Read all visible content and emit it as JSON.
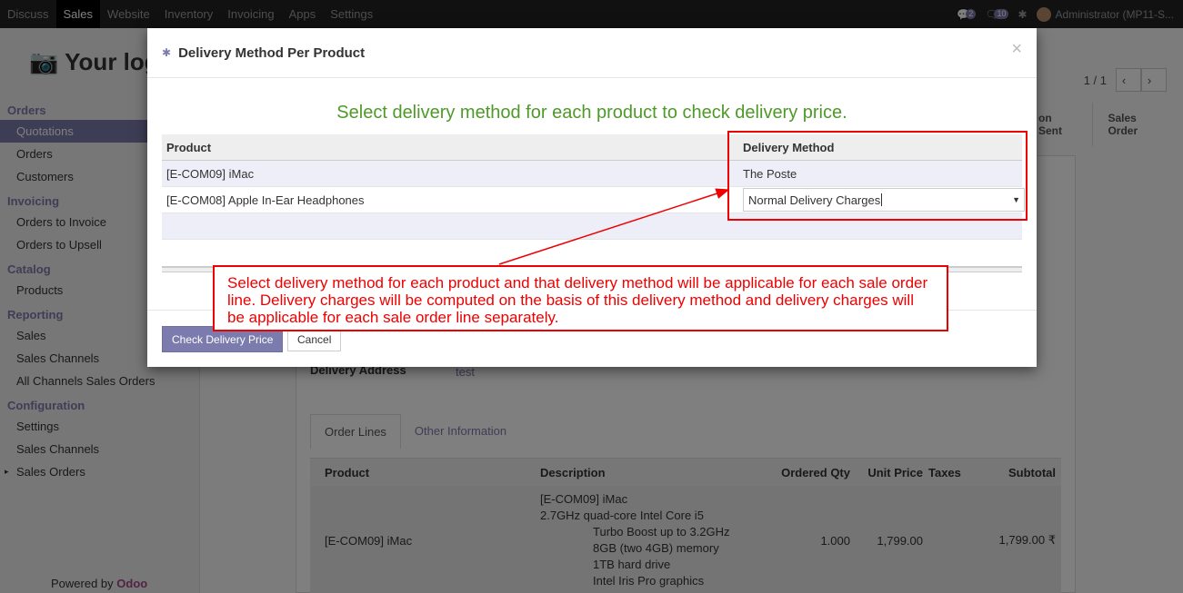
{
  "topbar": {
    "menu": [
      "Discuss",
      "Sales",
      "Website",
      "Inventory",
      "Invoicing",
      "Apps",
      "Settings"
    ],
    "active_index": 1,
    "chat_badge": "2",
    "activity_badge": "10",
    "user": "Administrator (MP11-S..."
  },
  "sidebar": {
    "logo": "Your log",
    "sections": [
      {
        "title": "Orders",
        "items": [
          "Quotations",
          "Orders",
          "Customers"
        ]
      },
      {
        "title": "Invoicing",
        "items": [
          "Orders to Invoice",
          "Orders to Upsell"
        ]
      },
      {
        "title": "Catalog",
        "items": [
          "Products"
        ]
      },
      {
        "title": "Reporting",
        "items": [
          "Sales",
          "Sales Channels",
          "All Channels Sales Orders"
        ]
      },
      {
        "title": "Configuration",
        "items": [
          "Settings",
          "Sales Channels",
          "Sales Orders"
        ]
      }
    ],
    "active_item": "Quotations",
    "powered_by": "Powered by",
    "powered_brand": "Odoo"
  },
  "main": {
    "pager": "1 / 1",
    "status_steps": [
      "on Sent",
      "Sales Order"
    ],
    "delivery_address_label": "Delivery Address",
    "delivery_address_value": "test",
    "tabs": [
      "Order Lines",
      "Other Information"
    ],
    "lines_headers": [
      "Product",
      "Description",
      "Ordered Qty",
      "Unit Price",
      "Taxes",
      "Subtotal"
    ],
    "line": {
      "product": "[E-COM09] iMac",
      "description": [
        "[E-COM09] iMac",
        "2.7GHz quad-core Intel Core i5"
      ],
      "description_indented": [
        "Turbo Boost up to 3.2GHz",
        "8GB (two 4GB) memory",
        "1TB hard drive",
        "Intel Iris Pro graphics"
      ],
      "qty": "1.000",
      "unit_price": "1,799.00",
      "taxes": "",
      "subtotal": "1,799.00 ₹"
    }
  },
  "modal": {
    "title": "Delivery Method Per Product",
    "close": "×",
    "subtitle": "Select delivery method for each product to check delivery price.",
    "headers": {
      "product": "Product",
      "method": "Delivery Method"
    },
    "rows": [
      {
        "product": "[E-COM09] iMac",
        "method": "The Poste"
      },
      {
        "product": "[E-COM08] Apple In-Ear Headphones",
        "method": "Normal Delivery Charges"
      }
    ],
    "check_button": "Check Delivery Price",
    "cancel_button": "Cancel"
  },
  "annotation": {
    "text": "Select delivery method for each product and that delivery method will be applicable for each sale order line. Delivery charges will be computed on the basis of this delivery method and delivery charges will be applicable for each sale order line separately.",
    "color": "#e00000"
  },
  "colors": {
    "brand": "#7c7bad",
    "subtitle": "#4e9a28"
  }
}
